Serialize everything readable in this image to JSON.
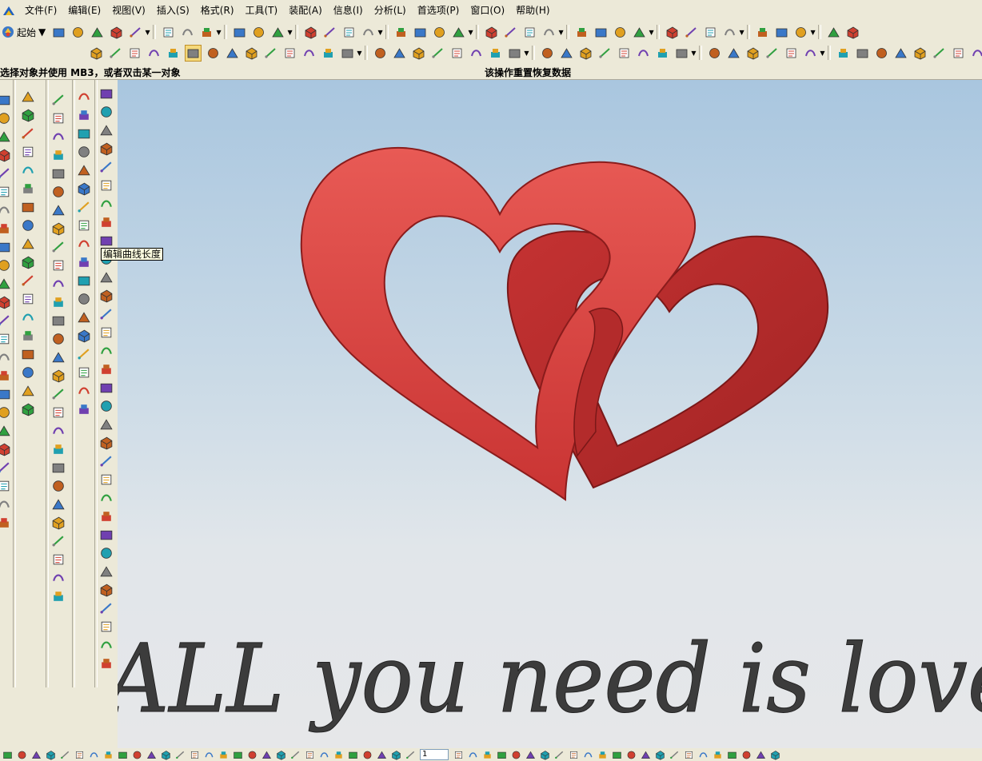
{
  "menu": {
    "items": [
      "文件(F)",
      "编辑(E)",
      "视图(V)",
      "插入(S)",
      "格式(R)",
      "工具(T)",
      "装配(A)",
      "信息(I)",
      "分析(L)",
      "首选项(P)",
      "窗口(O)",
      "帮助(H)"
    ]
  },
  "toolbar": {
    "start_label": "起始"
  },
  "status": {
    "left_text": "选择对象并使用 MB3，或者双击某一对象",
    "right_text": "该操作重置恢复数据"
  },
  "tooltip": {
    "text": "编辑曲线长度"
  },
  "viewport": {
    "model_text": "ALL you need is love"
  },
  "bottom_toolbar": {
    "layer_value": "1"
  },
  "colors": {
    "heart_red": "#d8403f",
    "heart_dark": "#a82828",
    "text_gray": "#3c3c3c"
  }
}
